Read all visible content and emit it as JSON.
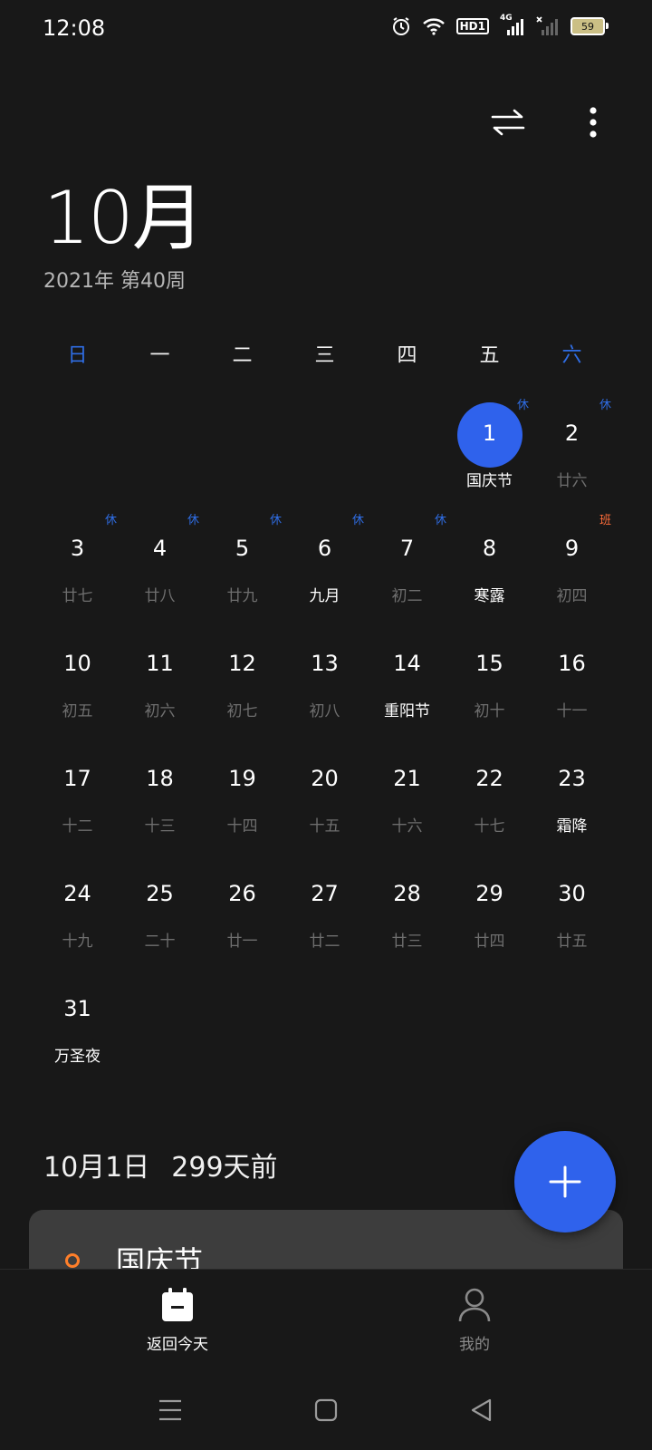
{
  "status": {
    "time": "12:08",
    "battery": "59",
    "hd_label": "HD1",
    "network_label": "4G"
  },
  "header": {
    "month": "10月",
    "subtitle": "2021年 第40周"
  },
  "weekdays": [
    "日",
    "一",
    "二",
    "三",
    "四",
    "五",
    "六"
  ],
  "days": [
    {
      "num": "1",
      "sub": "国庆节",
      "tag": "休",
      "today": true,
      "hl": true
    },
    {
      "num": "2",
      "sub": "廿六",
      "tag": "休"
    },
    {
      "num": "3",
      "sub": "廿七",
      "tag": "休"
    },
    {
      "num": "4",
      "sub": "廿八",
      "tag": "休"
    },
    {
      "num": "5",
      "sub": "廿九",
      "tag": "休"
    },
    {
      "num": "6",
      "sub": "九月",
      "tag": "休",
      "hl": true
    },
    {
      "num": "7",
      "sub": "初二",
      "tag": "休"
    },
    {
      "num": "8",
      "sub": "寒露",
      "hl": true
    },
    {
      "num": "9",
      "sub": "初四",
      "tag": "班",
      "work": true
    },
    {
      "num": "10",
      "sub": "初五"
    },
    {
      "num": "11",
      "sub": "初六"
    },
    {
      "num": "12",
      "sub": "初七"
    },
    {
      "num": "13",
      "sub": "初八"
    },
    {
      "num": "14",
      "sub": "重阳节",
      "hl": true
    },
    {
      "num": "15",
      "sub": "初十"
    },
    {
      "num": "16",
      "sub": "十一"
    },
    {
      "num": "17",
      "sub": "十二"
    },
    {
      "num": "18",
      "sub": "十三"
    },
    {
      "num": "19",
      "sub": "十四"
    },
    {
      "num": "20",
      "sub": "十五"
    },
    {
      "num": "21",
      "sub": "十六"
    },
    {
      "num": "22",
      "sub": "十七"
    },
    {
      "num": "23",
      "sub": "霜降",
      "hl": true
    },
    {
      "num": "24",
      "sub": "十九"
    },
    {
      "num": "25",
      "sub": "二十"
    },
    {
      "num": "26",
      "sub": "廿一"
    },
    {
      "num": "27",
      "sub": "廿二"
    },
    {
      "num": "28",
      "sub": "廿三"
    },
    {
      "num": "29",
      "sub": "廿四"
    },
    {
      "num": "30",
      "sub": "廿五"
    },
    {
      "num": "31",
      "sub": "万圣夜",
      "hl": true
    }
  ],
  "event_header": {
    "date": "10月1日",
    "relative": "299天前"
  },
  "event": {
    "title": "国庆节"
  },
  "bottom_nav": {
    "today_label": "返回今天",
    "me_label": "我的"
  },
  "colors": {
    "accent": "#2f62ec",
    "holiday_tag": "#2f6de4",
    "work_tag": "#ff6d3a",
    "event_dot": "#ff7f2a",
    "background": "#181818"
  }
}
